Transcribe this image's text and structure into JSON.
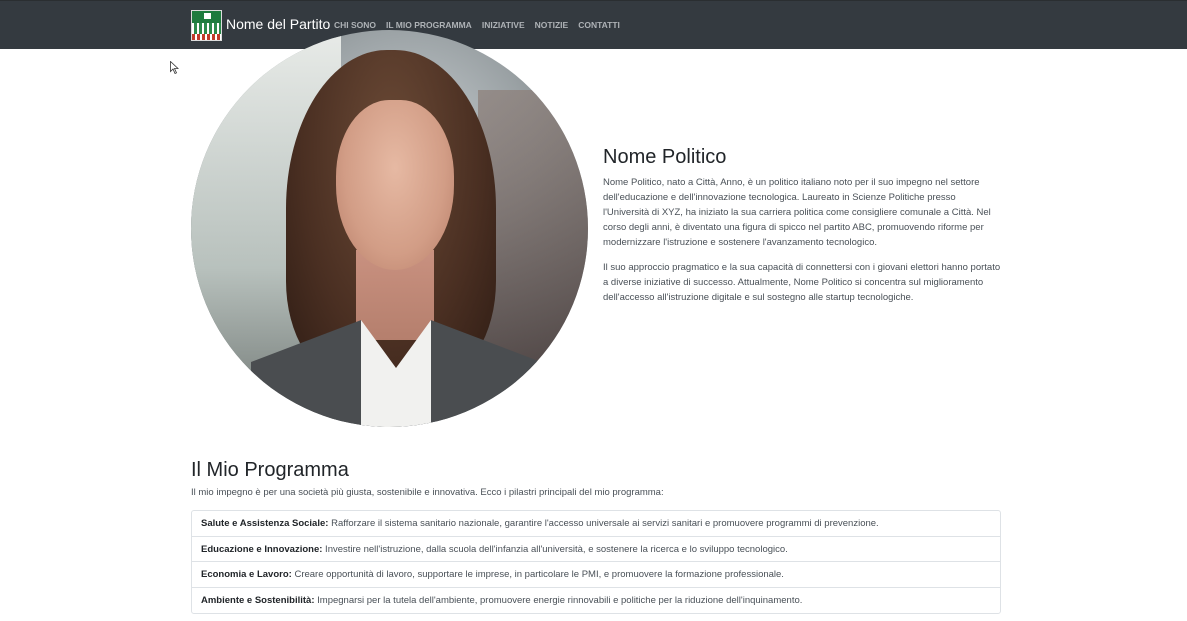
{
  "nav": {
    "brand": "Nome del Partito",
    "links": [
      "CHI SONO",
      "IL MIO PROGRAMMA",
      "INIZIATIVE",
      "NOTIZIE",
      "CONTATTI"
    ]
  },
  "about": {
    "name": "Nome Politico",
    "paragraphs": [
      "Nome Politico, nato a Città, Anno, è un politico italiano noto per il suo impegno nel settore dell'educazione e dell'innovazione tecnologica. Laureato in Scienze Politiche presso l'Università di XYZ, ha iniziato la sua carriera politica come consigliere comunale a Città. Nel corso degli anni, è diventato una figura di spicco nel partito ABC, promuovendo riforme per modernizzare l'istruzione e sostenere l'avanzamento tecnologico.",
      "Il suo approccio pragmatico e la sua capacità di connettersi con i giovani elettori hanno portato a diverse iniziative di successo. Attualmente, Nome Politico si concentra sul miglioramento dell'accesso all'istruzione digitale e sul sostegno alle startup tecnologiche."
    ]
  },
  "program": {
    "title": "Il Mio Programma",
    "intro": "Il mio impegno è per una società più giusta, sostenibile e innovativa. Ecco i pilastri principali del mio programma:",
    "items": [
      {
        "title": "Salute e Assistenza Sociale:",
        "text": " Rafforzare il sistema sanitario nazionale, garantire l'accesso universale ai servizi sanitari e promuovere programmi di prevenzione."
      },
      {
        "title": "Educazione e Innovazione:",
        "text": " Investire nell'istruzione, dalla scuola dell'infanzia all'università, e sostenere la ricerca e lo sviluppo tecnologico."
      },
      {
        "title": "Economia e Lavoro:",
        "text": " Creare opportunità di lavoro, supportare le imprese, in particolare le PMI, e promuovere la formazione professionale."
      },
      {
        "title": "Ambiente e Sostenibilità:",
        "text": " Impegnarsi per la tutela dell'ambiente, promuovere energie rinnovabili e politiche per la riduzione dell'inquinamento."
      }
    ]
  }
}
